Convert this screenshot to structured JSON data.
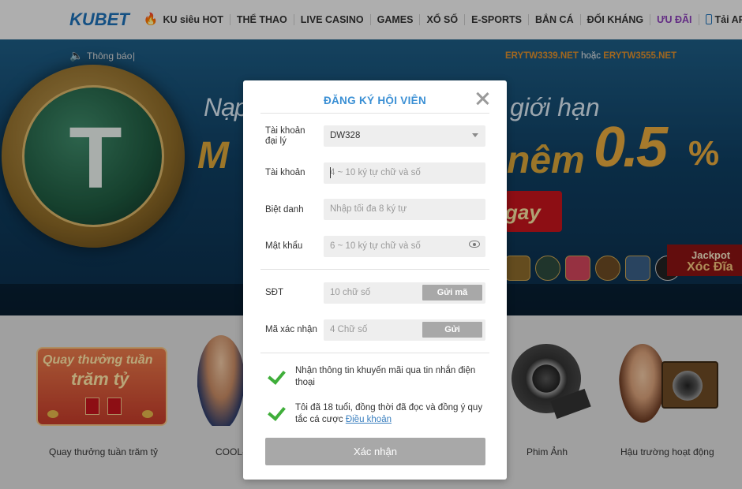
{
  "nav": {
    "logo": "KUBET",
    "items": [
      {
        "label": "KU siêu HOT",
        "icon": "fire-icon"
      },
      {
        "label": "THỂ THAO"
      },
      {
        "label": "LIVE CASINO"
      },
      {
        "label": "GAMES"
      },
      {
        "label": "XỔ SỐ"
      },
      {
        "label": "E-SPORTS"
      },
      {
        "label": "BẮN CÁ"
      },
      {
        "label": "ĐỐI KHÁNG"
      },
      {
        "label": "ƯU ĐÃI"
      },
      {
        "label": "Tải APP",
        "icon": "phone-icon"
      }
    ]
  },
  "banner": {
    "line1_left": "Nạp",
    "line1_right": "giới hạn",
    "line2_left": "M",
    "line2_right": "nêm",
    "percent": "0.5",
    "percent_sign": "%",
    "button_label": "gay",
    "ticker_label": "Thông báo",
    "ticker_sep": "|",
    "ticker_url1": "ERYTW3339.NET",
    "ticker_word": " hoặc ",
    "ticker_url2": "ERYTW3555.NET",
    "jackpot_line1": "Jackpot",
    "jackpot_line2": "Xóc Đĩa"
  },
  "promo": {
    "quay_line1": "Quay thưởng tuần",
    "quay_line2": "trăm tỷ",
    "captions": [
      "Quay thưởng tuần trăm tỷ",
      "COOL-",
      "Phim Ảnh",
      "Hậu trường hoạt động"
    ]
  },
  "modal": {
    "title": "ĐĂNG KÝ HỘI VIÊN",
    "agent_label_1": "Tài khoản",
    "agent_label_2": "đại lý",
    "agent_value": "DW328",
    "account_label": "Tài khoản",
    "account_placeholder": "4 ~ 10 ký tự chữ và số",
    "nickname_label": "Biệt danh",
    "nickname_placeholder": "Nhập tối đa 8 ký tự",
    "password_label": "Mật khẩu",
    "password_placeholder": "6 ~ 10 ký tự chữ và số",
    "phone_label": "SĐT",
    "phone_placeholder": "10 chữ số",
    "send_code_label": "Gửi mã",
    "verify_label": "Mã xác nhận",
    "verify_placeholder": "4 Chữ số",
    "send_label": "Gửi",
    "check1_text": "Nhận thông tin khuyến mãi qua tin nhắn điện thoại",
    "check2_text": "Tôi đã 18 tuổi, đồng thời đã đọc và đồng ý quy tắc cá cược ",
    "terms_link": "Điều khoản",
    "submit_label": "Xác nhận"
  }
}
